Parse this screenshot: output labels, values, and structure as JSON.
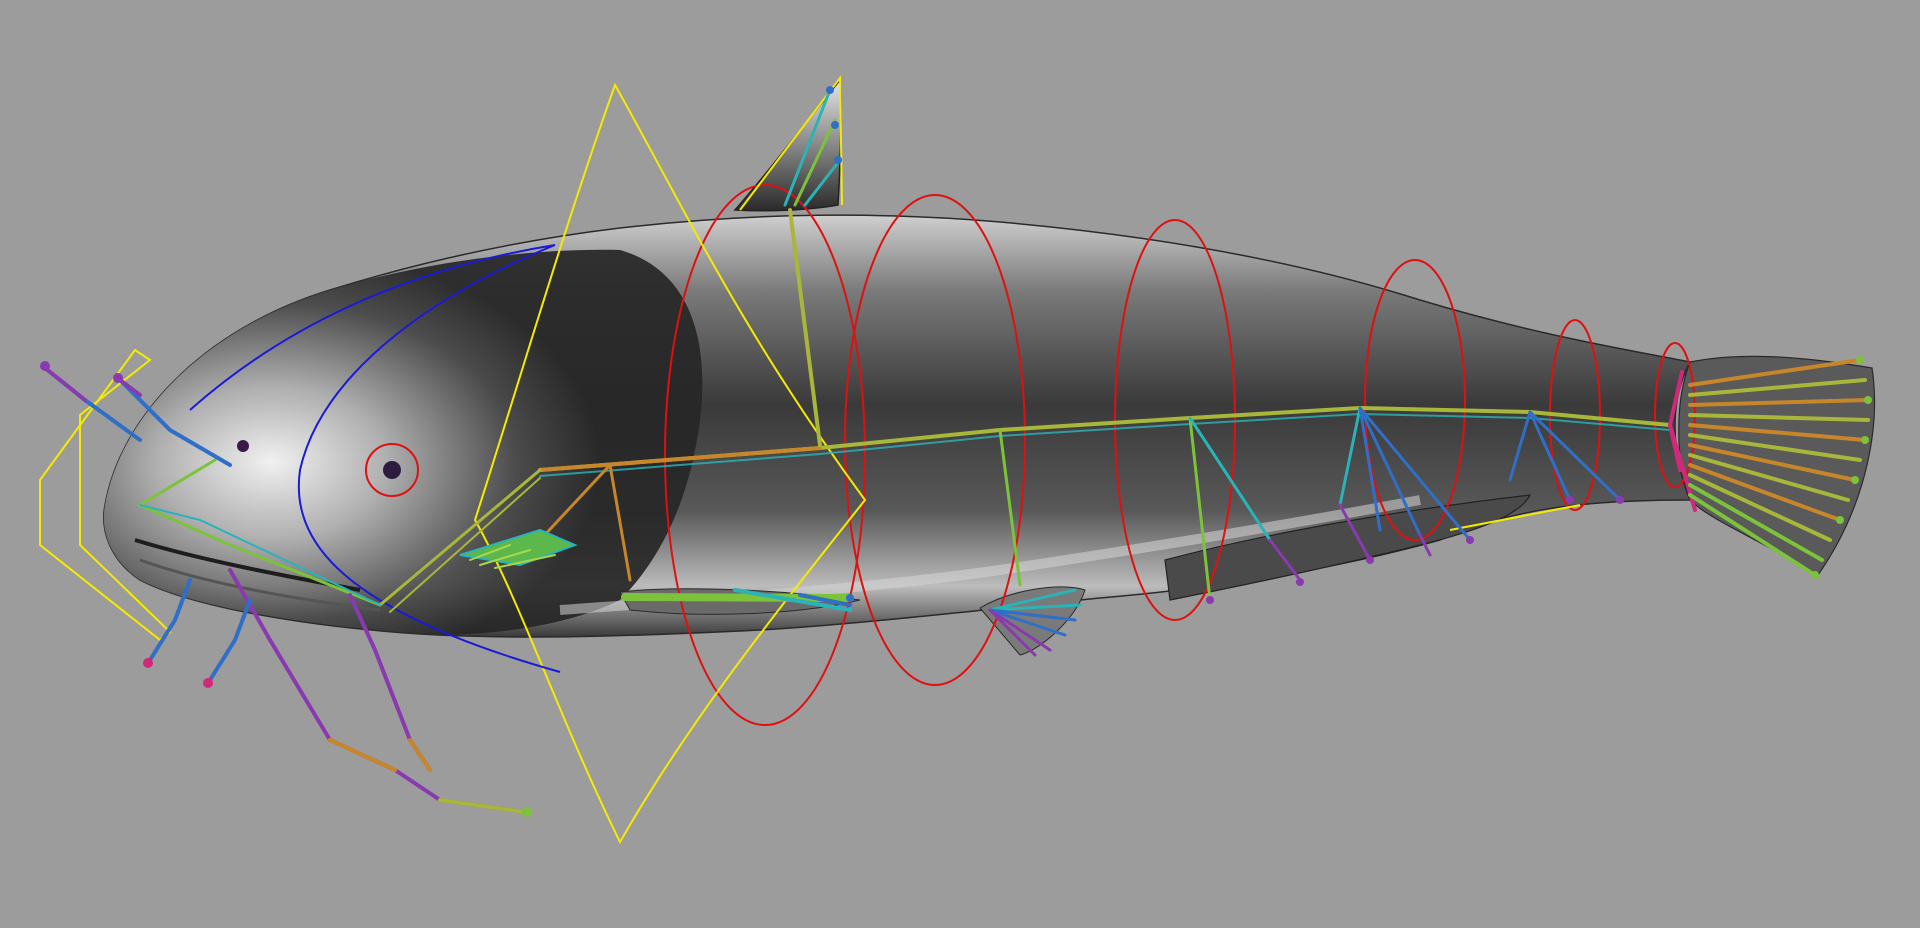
{
  "viewport": {
    "background": "#9c9c9c",
    "subject": "catfish-rig"
  },
  "colors": {
    "body_light": "#f2f2f2",
    "body_mid": "#8a8a8a",
    "body_dark": "#2e2e2e",
    "nurbs_red": "#e01010",
    "nurbs_yellow": "#f5ea00",
    "nurbs_blue": "#1a1ad8",
    "joint_green": "#7cc23a",
    "joint_cyan": "#2ab3b8",
    "joint_blue": "#2f6fc8",
    "joint_orange": "#c8862a",
    "joint_purple": "#8a3ab0",
    "joint_magenta": "#d0287a"
  },
  "icons": {
    "barbel": "whisker-joint-chain-icon",
    "fin_ray": "fin-ray-joint-icon",
    "control": "nurbs-control-curve-icon"
  }
}
